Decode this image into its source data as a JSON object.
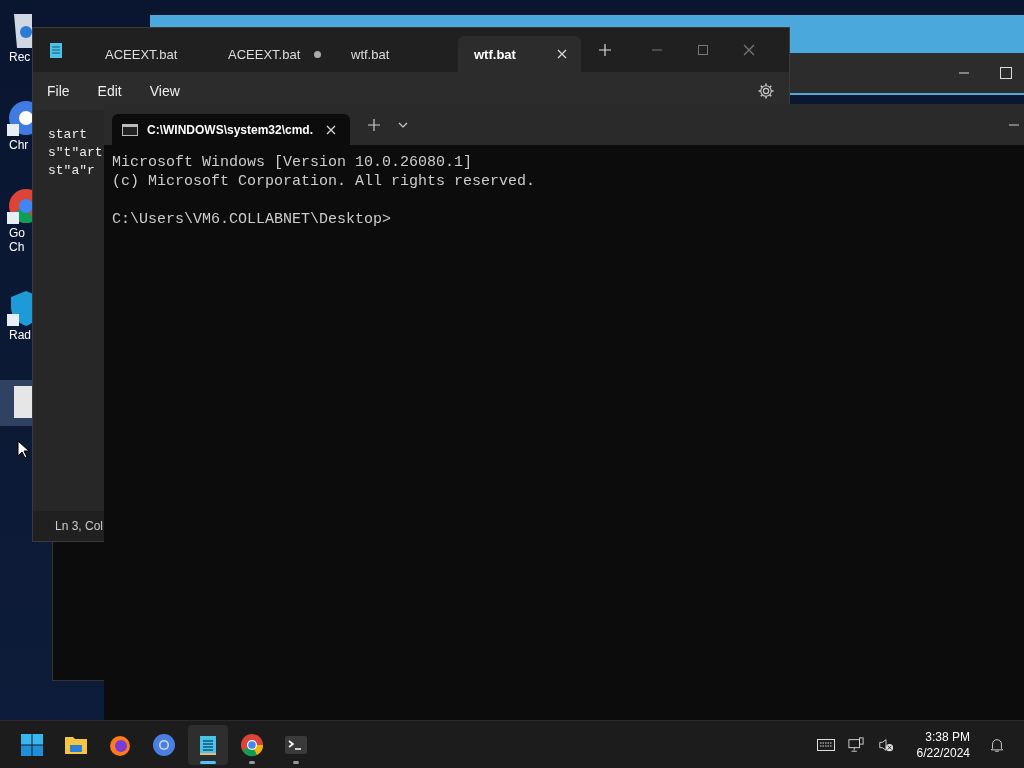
{
  "desktop_icons": [
    {
      "kind": "bin",
      "lines": [
        "Rec"
      ],
      "selected": false
    },
    {
      "kind": "chromium",
      "lines": [
        "Chr"
      ],
      "selected": false
    },
    {
      "kind": "chrome",
      "lines": [
        "Go",
        "Ch"
      ],
      "selected": false
    },
    {
      "kind": "shield",
      "lines": [
        "Rad"
      ],
      "selected": false
    },
    {
      "kind": "file",
      "selected": true
    }
  ],
  "notepad": {
    "tabs": [
      {
        "label": "ACEEXT.bat",
        "selected": false,
        "modified": false
      },
      {
        "label": "ACEEXT.bat",
        "selected": false,
        "modified": true
      },
      {
        "label": "wtf.bat",
        "selected": false,
        "modified": false
      },
      {
        "label": "wtf.bat",
        "selected": true,
        "modified": false
      }
    ],
    "menu": [
      "File",
      "Edit",
      "View"
    ],
    "lines": [
      "start",
      "s\"t\"art",
      "st\"a\"r"
    ],
    "status": "Ln 3, Col"
  },
  "terminal": {
    "tab": "C:\\WINDOWS\\system32\\cmd.",
    "blocks": [
      [
        "Microsoft Windows [Version 10.0.26080.1]",
        "(c) Microsoft Corporation. All rights reserved."
      ],
      [
        "C:\\Users\\VM6.COLLABNET\\Desktop>"
      ]
    ]
  },
  "taskbar": {
    "apps": [
      {
        "kind": "start",
        "active": false,
        "running": false
      },
      {
        "kind": "folder",
        "active": false,
        "running": false
      },
      {
        "kind": "firefox",
        "active": false,
        "running": false
      },
      {
        "kind": "chromium",
        "active": false,
        "running": false
      },
      {
        "kind": "notepad",
        "active": true,
        "running": true
      },
      {
        "kind": "chrome",
        "active": false,
        "running": true
      },
      {
        "kind": "terminal",
        "active": false,
        "running": true
      }
    ],
    "time": "3:38 PM",
    "date": "6/22/2024"
  }
}
